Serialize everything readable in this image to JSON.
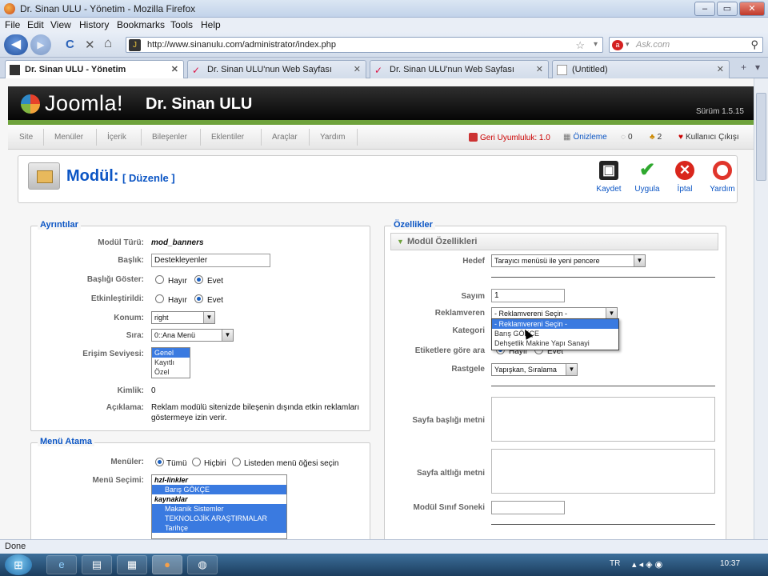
{
  "window": {
    "title": "Dr. Sinan ULU - Yönetim - Mozilla Firefox",
    "min": "–",
    "max": "▭",
    "close": "✕"
  },
  "menubar": [
    "File",
    "Edit",
    "View",
    "History",
    "Bookmarks",
    "Tools",
    "Help"
  ],
  "nav": {
    "back": "◀",
    "forward": "▶",
    "reload": "C",
    "stop": "✕",
    "home": "⌂",
    "url": "http://www.sinanulu.com/administrator/index.php",
    "star": "☆",
    "dd": "▾",
    "search_placeholder": "Ask.com",
    "search_engine": "a",
    "mag": "⚲"
  },
  "tabs": [
    {
      "label": "Dr. Sinan ULU - Yönetim",
      "close": "✕"
    },
    {
      "label": "Dr. Sinan ULU'nun Web Sayfası",
      "close": "✕"
    },
    {
      "label": "Dr. Sinan ULU'nun Web Sayfası",
      "close": "✕"
    },
    {
      "label": "(Untitled)",
      "close": "✕"
    }
  ],
  "tabctl": {
    "new": "+",
    "list": "▾"
  },
  "joomla": {
    "logo": "Joomla!",
    "site": "Dr. Sinan ULU",
    "version": "Sürüm 1.5.15"
  },
  "jmenu": [
    "Site",
    "Menüler",
    "İçerik",
    "Bileşenler",
    "Eklentiler",
    "Araçlar",
    "Yardım"
  ],
  "jstatus": {
    "legacy": "Geri Uyumluluk: 1.0",
    "preview": "Önizleme",
    "msgs": "0",
    "users": "2",
    "logout": "Kullanıcı Çıkışı"
  },
  "page": {
    "title": "Modül:",
    "subtitle": "[ Düzenle ]"
  },
  "toolbar": {
    "save": "Kaydet",
    "apply": "Uygula",
    "cancel": "İptal",
    "help": "Yardım"
  },
  "details": {
    "legend": "Ayrıntılar",
    "labels": {
      "type": "Modül Türü:",
      "title": "Başlık:",
      "show_title": "Başlığı Göster:",
      "enabled": "Etkinleştirildi:",
      "position": "Konum:",
      "order": "Sıra:",
      "access": "Erişim Seviyesi:",
      "id": "Kimlik:",
      "desc": "Açıklama:"
    },
    "type": "mod_banners",
    "title": "Destekleyenler",
    "no": "Hayır",
    "yes": "Evet",
    "position": "right",
    "order": "0::Ana Menü",
    "access": [
      "Genel",
      "Kayıtlı",
      "Özel"
    ],
    "id": "0",
    "desc1": "Reklam modülü sitenizde bileşenin dışında etkin reklamları",
    "desc2": "göstermeye izin verir."
  },
  "menu": {
    "legend": "Menü Atama",
    "labels": {
      "menus": "Menüler:",
      "select": "Menü Seçimi:"
    },
    "opts": [
      "Tümü",
      "Hiçbiri",
      "Listeden menü öğesi seçin"
    ],
    "list": [
      "hzl-linkler",
      "Barış GÖKÇE",
      "kaynaklar",
      "Makanik Sistemler",
      "TEKNOLOJİK ARAŞTIRMALAR",
      "Tarihçe"
    ]
  },
  "params": {
    "legend": "Özellikler",
    "pane": "Modül Özellikleri",
    "labels": {
      "target": "Hedef",
      "count": "Sayım",
      "client": "Reklamveren",
      "category": "Kategori",
      "tags": "Etiketlere göre ara",
      "random": "Rastgele",
      "header": "Sayfa başlığı metni",
      "footer": "Sayfa altlığı metni",
      "suffix": "Modül Sınıf Soneki"
    },
    "target": "Tarayıcı menüsü ile yeni pencere",
    "count": "1",
    "client": "- Reklamvereni Seçin -",
    "dropdown": [
      "- Reklamvereni Seçin -",
      "Barış GÖKÇE",
      "Dehşetlik Makine Yapı Sanayi"
    ],
    "no": "Hayır",
    "yes": "Evet",
    "random": "Yapışkan, Sıralama"
  },
  "status": "Done",
  "taskbar": {
    "start": "⊞",
    "lang": "TR",
    "time": "10:37"
  }
}
